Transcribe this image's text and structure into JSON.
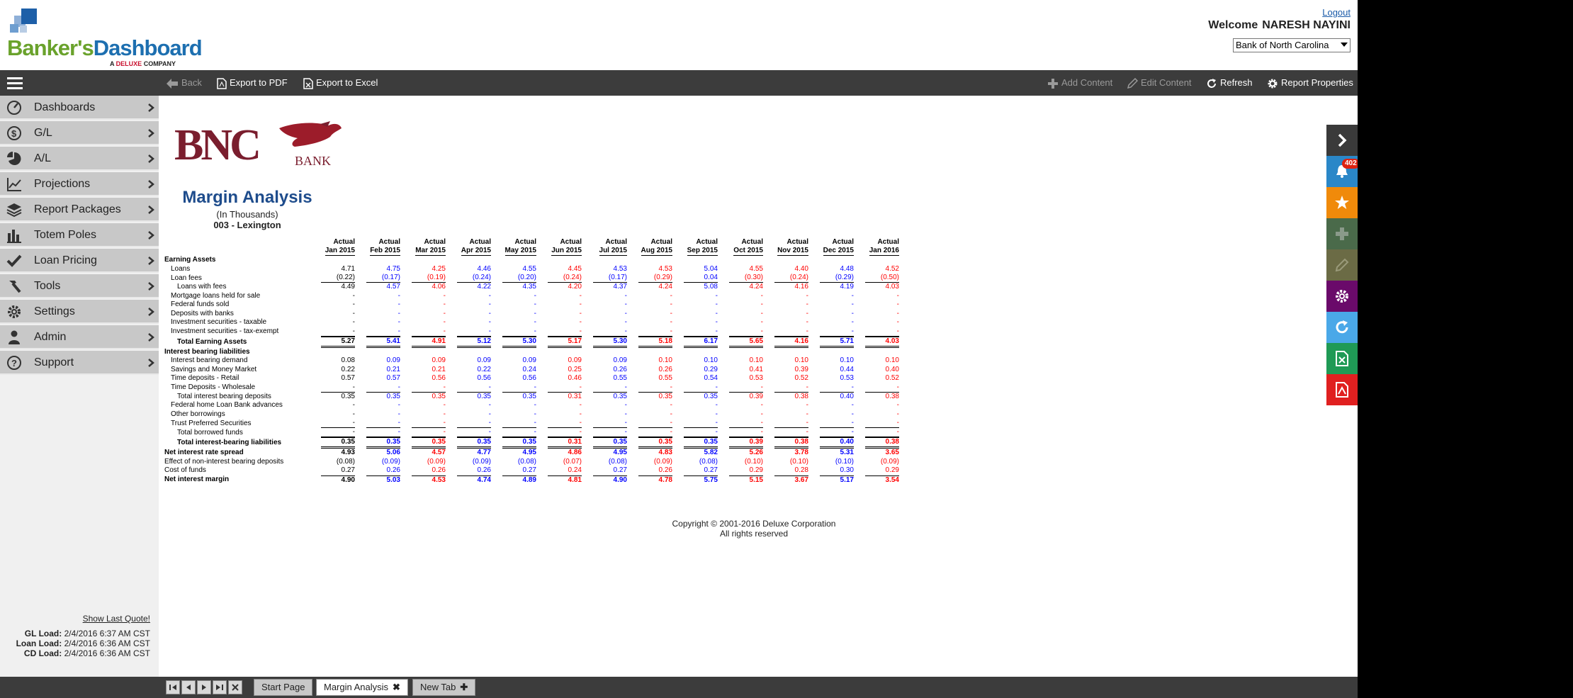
{
  "header": {
    "brand_part1": "Banker's",
    "brand_part2": "Dashboard",
    "sub_prefix": "A ",
    "sub_brand": "DELUXE",
    "sub_suffix": " COMPANY",
    "logout": "Logout",
    "welcome": "Welcome",
    "user": "NARESH NAYINI",
    "bank": "Bank of North Carolina"
  },
  "toolbar": {
    "back": "Back",
    "export_pdf": "Export to PDF",
    "export_excel": "Export to Excel",
    "add_content": "Add Content",
    "edit_content": "Edit Content",
    "refresh": "Refresh",
    "report_properties": "Report Properties"
  },
  "sidebar": {
    "items": [
      {
        "label": "Dashboards",
        "icon": "dashboard-icon"
      },
      {
        "label": "G/L",
        "icon": "dollar-icon"
      },
      {
        "label": "A/L",
        "icon": "pie-icon"
      },
      {
        "label": "Projections",
        "icon": "line-chart-icon"
      },
      {
        "label": "Report Packages",
        "icon": "layers-icon"
      },
      {
        "label": "Totem Poles",
        "icon": "bar-chart-icon"
      },
      {
        "label": "Loan Pricing",
        "icon": "check-icon"
      },
      {
        "label": "Tools",
        "icon": "hammer-icon"
      },
      {
        "label": "Settings",
        "icon": "gear-icon"
      },
      {
        "label": "Admin",
        "icon": "user-icon"
      },
      {
        "label": "Support",
        "icon": "help-icon"
      }
    ],
    "show_last_quote": "Show Last Quote!",
    "gl_load_label": "GL Load:",
    "gl_load_value": "2/4/2016 6:37 AM CST",
    "loan_load_label": "Loan Load:",
    "loan_load_value": "2/4/2016 6:36 AM CST",
    "cd_load_label": "CD Load:",
    "cd_load_value": "2/4/2016 6:36 AM CST"
  },
  "report": {
    "bank_logo_text": "BNC",
    "bank_logo_sub": "BANK",
    "title": "Margin Analysis",
    "subtitle": "(In Thousands)",
    "branch": "003 - Lexington",
    "columns": [
      {
        "top": "Actual",
        "bottom": "Jan 2015"
      },
      {
        "top": "Actual",
        "bottom": "Feb 2015"
      },
      {
        "top": "Actual",
        "bottom": "Mar 2015"
      },
      {
        "top": "Actual",
        "bottom": "Apr 2015"
      },
      {
        "top": "Actual",
        "bottom": "May 2015"
      },
      {
        "top": "Actual",
        "bottom": "Jun 2015"
      },
      {
        "top": "Actual",
        "bottom": "Jul 2015"
      },
      {
        "top": "Actual",
        "bottom": "Aug 2015"
      },
      {
        "top": "Actual",
        "bottom": "Sep 2015"
      },
      {
        "top": "Actual",
        "bottom": "Oct 2015"
      },
      {
        "top": "Actual",
        "bottom": "Nov 2015"
      },
      {
        "top": "Actual",
        "bottom": "Dec 2015"
      },
      {
        "top": "Actual",
        "bottom": "Jan 2016"
      }
    ],
    "column_colors": [
      "#000000",
      "#0000ff",
      "#ff0000",
      "#0000ff",
      "#0000ff",
      "#ff0000",
      "#0000ff",
      "#ff0000",
      "#0000ff",
      "#ff0000",
      "#ff0000",
      "#0000ff",
      "#ff0000"
    ],
    "rows": [
      {
        "label": "Earning Assets",
        "indent": 0,
        "style": "section",
        "values": []
      },
      {
        "label": "Loans",
        "indent": 1,
        "values": [
          "4.71",
          "4.75",
          "4.25",
          "4.46",
          "4.55",
          "4.45",
          "4.53",
          "4.53",
          "5.04",
          "4.55",
          "4.40",
          "4.48",
          "4.52"
        ]
      },
      {
        "label": "Loan fees",
        "indent": 1,
        "style": "ul",
        "values": [
          "(0.22)",
          "(0.17)",
          "(0.19)",
          "(0.24)",
          "(0.20)",
          "(0.24)",
          "(0.17)",
          "(0.29)",
          "0.04",
          "(0.30)",
          "(0.24)",
          "(0.29)",
          "(0.50)"
        ]
      },
      {
        "label": "Loans with fees",
        "indent": 2,
        "values": [
          "4.49",
          "4.57",
          "4.06",
          "4.22",
          "4.35",
          "4.20",
          "4.37",
          "4.24",
          "5.08",
          "4.24",
          "4.16",
          "4.19",
          "4.03"
        ]
      },
      {
        "label": "Mortgage loans held for sale",
        "indent": 1,
        "values": [
          "-",
          "-",
          "-",
          "-",
          "-",
          "-",
          "-",
          "-",
          "-",
          "-",
          "-",
          "-",
          "-"
        ]
      },
      {
        "label": "Federal funds sold",
        "indent": 1,
        "values": [
          "-",
          "-",
          "-",
          "-",
          "-",
          "-",
          "-",
          "-",
          "-",
          "-",
          "-",
          "-",
          "-"
        ]
      },
      {
        "label": "Deposits with banks",
        "indent": 1,
        "values": [
          "-",
          "-",
          "-",
          "-",
          "-",
          "-",
          "-",
          "-",
          "-",
          "-",
          "-",
          "-",
          "-"
        ]
      },
      {
        "label": "Investment securities - taxable",
        "indent": 1,
        "values": [
          "-",
          "-",
          "-",
          "-",
          "-",
          "-",
          "-",
          "-",
          "-",
          "-",
          "-",
          "-",
          "-"
        ]
      },
      {
        "label": "Investment securities - tax-exempt",
        "indent": 1,
        "style": "ul",
        "values": [
          "-",
          "-",
          "-",
          "-",
          "-",
          "-",
          "-",
          "-",
          "-",
          "-",
          "-",
          "-",
          "-"
        ]
      },
      {
        "label": "Total Earning Assets",
        "indent": 2,
        "style": "bold dul",
        "values": [
          "5.27",
          "5.41",
          "4.91",
          "5.12",
          "5.30",
          "5.17",
          "5.30",
          "5.18",
          "6.17",
          "5.65",
          "4.16",
          "5.71",
          "4.03"
        ]
      },
      {
        "label": "Interest bearing liabilities",
        "indent": 0,
        "style": "section",
        "values": []
      },
      {
        "label": "Interest bearing demand",
        "indent": 1,
        "values": [
          "0.08",
          "0.09",
          "0.09",
          "0.09",
          "0.09",
          "0.09",
          "0.09",
          "0.10",
          "0.10",
          "0.10",
          "0.10",
          "0.10",
          "0.10"
        ]
      },
      {
        "label": "Savings and Money Market",
        "indent": 1,
        "values": [
          "0.22",
          "0.21",
          "0.21",
          "0.22",
          "0.24",
          "0.25",
          "0.26",
          "0.26",
          "0.29",
          "0.41",
          "0.39",
          "0.44",
          "0.40"
        ]
      },
      {
        "label": "Time deposits - Retail",
        "indent": 1,
        "values": [
          "0.57",
          "0.57",
          "0.56",
          "0.56",
          "0.56",
          "0.46",
          "0.55",
          "0.55",
          "0.54",
          "0.53",
          "0.52",
          "0.53",
          "0.52"
        ]
      },
      {
        "label": "Time Deposits - Wholesale",
        "indent": 1,
        "style": "ul",
        "values": [
          "-",
          "-",
          "-",
          "-",
          "-",
          "-",
          "-",
          "-",
          "-",
          "-",
          "-",
          "-",
          "-"
        ]
      },
      {
        "label": "Total interest bearing deposits",
        "indent": 2,
        "values": [
          "0.35",
          "0.35",
          "0.35",
          "0.35",
          "0.35",
          "0.31",
          "0.35",
          "0.35",
          "0.35",
          "0.39",
          "0.38",
          "0.40",
          "0.38"
        ]
      },
      {
        "label": "Federal home Loan Bank advances",
        "indent": 1,
        "values": [
          "-",
          "-",
          "-",
          "-",
          "-",
          "-",
          "-",
          "-",
          "-",
          "-",
          "-",
          "-",
          "-"
        ]
      },
      {
        "label": "Other borrowings",
        "indent": 1,
        "values": [
          "-",
          "-",
          "-",
          "-",
          "-",
          "-",
          "-",
          "-",
          "-",
          "-",
          "-",
          "-",
          "-"
        ]
      },
      {
        "label": "Trust Preferred Securities",
        "indent": 1,
        "style": "ul",
        "values": [
          "-",
          "-",
          "-",
          "-",
          "-",
          "-",
          "-",
          "-",
          "-",
          "-",
          "-",
          "-",
          "-"
        ]
      },
      {
        "label": "Total borrowed funds",
        "indent": 2,
        "style": "ul",
        "values": [
          "-",
          "-",
          "-",
          "-",
          "-",
          "-",
          "-",
          "-",
          "-",
          "-",
          "-",
          "-",
          "-"
        ]
      },
      {
        "label": "Total interest-bearing liabilities",
        "indent": 2,
        "style": "bold dul",
        "values": [
          "0.35",
          "0.35",
          "0.35",
          "0.35",
          "0.35",
          "0.31",
          "0.35",
          "0.35",
          "0.35",
          "0.39",
          "0.38",
          "0.40",
          "0.38"
        ]
      },
      {
        "label": "Net interest rate spread",
        "indent": 0,
        "style": "bold",
        "values": [
          "4.93",
          "5.06",
          "4.57",
          "4.77",
          "4.95",
          "4.86",
          "4.95",
          "4.83",
          "5.82",
          "5.26",
          "3.78",
          "5.31",
          "3.65"
        ]
      },
      {
        "label": "Effect of non-interest bearing deposits",
        "indent": 0,
        "values": [
          "(0.08)",
          "(0.09)",
          "(0.09)",
          "(0.09)",
          "(0.08)",
          "(0.07)",
          "(0.08)",
          "(0.09)",
          "(0.08)",
          "(0.10)",
          "(0.10)",
          "(0.10)",
          "(0.09)"
        ]
      },
      {
        "label": "Cost of funds",
        "indent": 0,
        "values": [
          "0.27",
          "0.26",
          "0.26",
          "0.26",
          "0.27",
          "0.24",
          "0.27",
          "0.26",
          "0.27",
          "0.29",
          "0.28",
          "0.30",
          "0.29"
        ]
      },
      {
        "label": "Net interest margin",
        "indent": 0,
        "style": "bold tl",
        "values": [
          "4.90",
          "5.03",
          "4.53",
          "4.74",
          "4.89",
          "4.81",
          "4.90",
          "4.78",
          "5.75",
          "5.15",
          "3.67",
          "5.17",
          "3.54"
        ]
      }
    ],
    "copyright_1": "Copyright © 2001-2016 Deluxe Corporation",
    "copyright_2": "All rights reserved"
  },
  "rail": {
    "notifications_count": "402",
    "colors": [
      "#3a3a3a",
      "#2a87c8",
      "#f08a0a",
      "#4a6a4a",
      "#6b6b45",
      "#6a0a6a",
      "#4aa8e8",
      "#1f9a55",
      "#e02020"
    ]
  },
  "tabs": {
    "items": [
      {
        "label": "Start Page",
        "active": false,
        "closable": false
      },
      {
        "label": "Margin Analysis",
        "active": true,
        "closable": true
      },
      {
        "label": "New Tab",
        "active": false,
        "closable": false,
        "add": true
      }
    ],
    "close_glyph": "✖",
    "add_glyph": "✚"
  }
}
